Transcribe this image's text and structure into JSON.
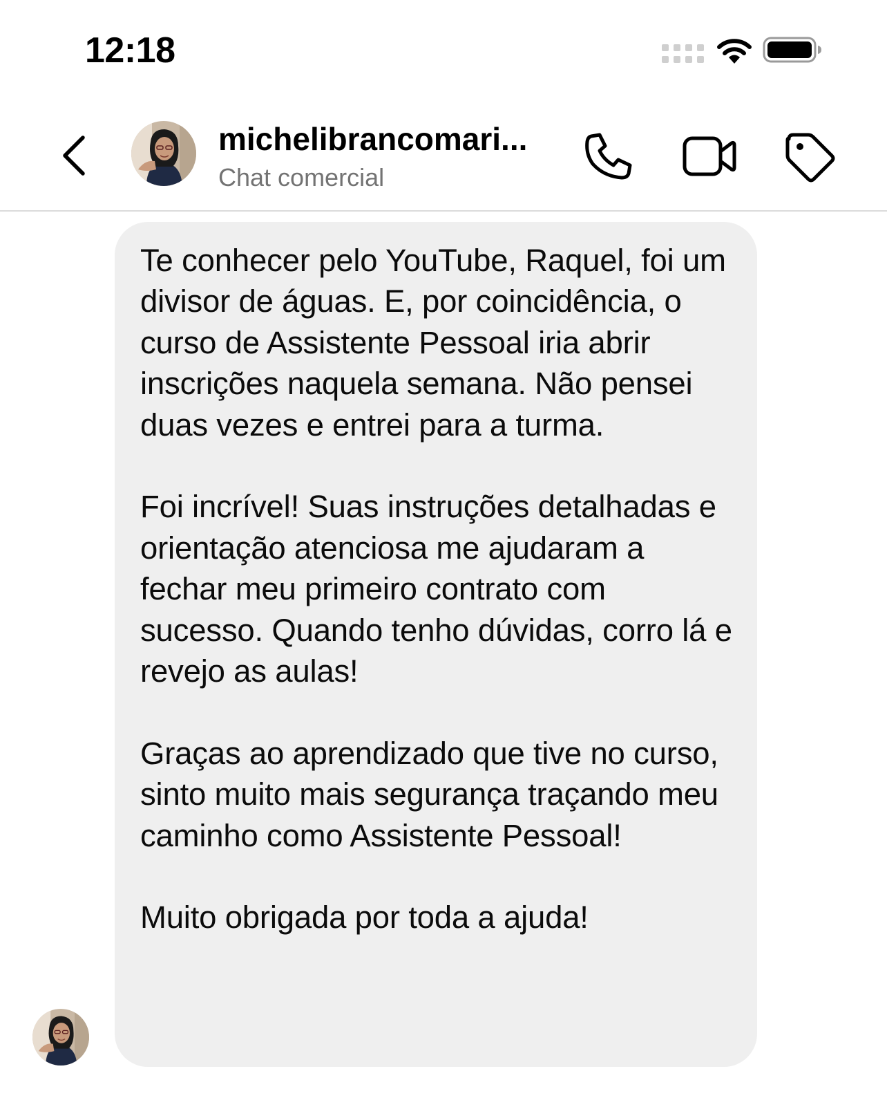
{
  "status_bar": {
    "time": "12:18",
    "icons": [
      "signal-dots-icon",
      "wifi-icon",
      "battery-icon"
    ]
  },
  "header": {
    "username": "michelibrancomari...",
    "subtitle": "Chat comercial",
    "icons": [
      "back-chevron-icon",
      "phone-icon",
      "video-camera-icon",
      "tag-icon"
    ]
  },
  "message": {
    "paragraphs": [
      "Te conhecer pelo YouTube, Raquel, foi um divisor de águas. E, por coincidência, o curso de Assistente Pessoal iria abrir inscrições naquela semana. Não pensei duas vezes e entrei para a turma.",
      "Foi incrível! Suas instruções detalhadas e orientação atenciosa me ajudaram a fechar meu primeiro contrato com sucesso. Quando tenho dúvidas, corro lá e revejo as aulas!",
      "Graças ao aprendizado que tive no curso, sinto muito mais segurança traçando meu caminho como Assistente Pessoal!",
      "Muito obrigada por toda a ajuda!"
    ]
  },
  "colors": {
    "bubble_background": "#efefef",
    "subtitle_gray": "#737373",
    "divider": "#dbdbdb"
  }
}
